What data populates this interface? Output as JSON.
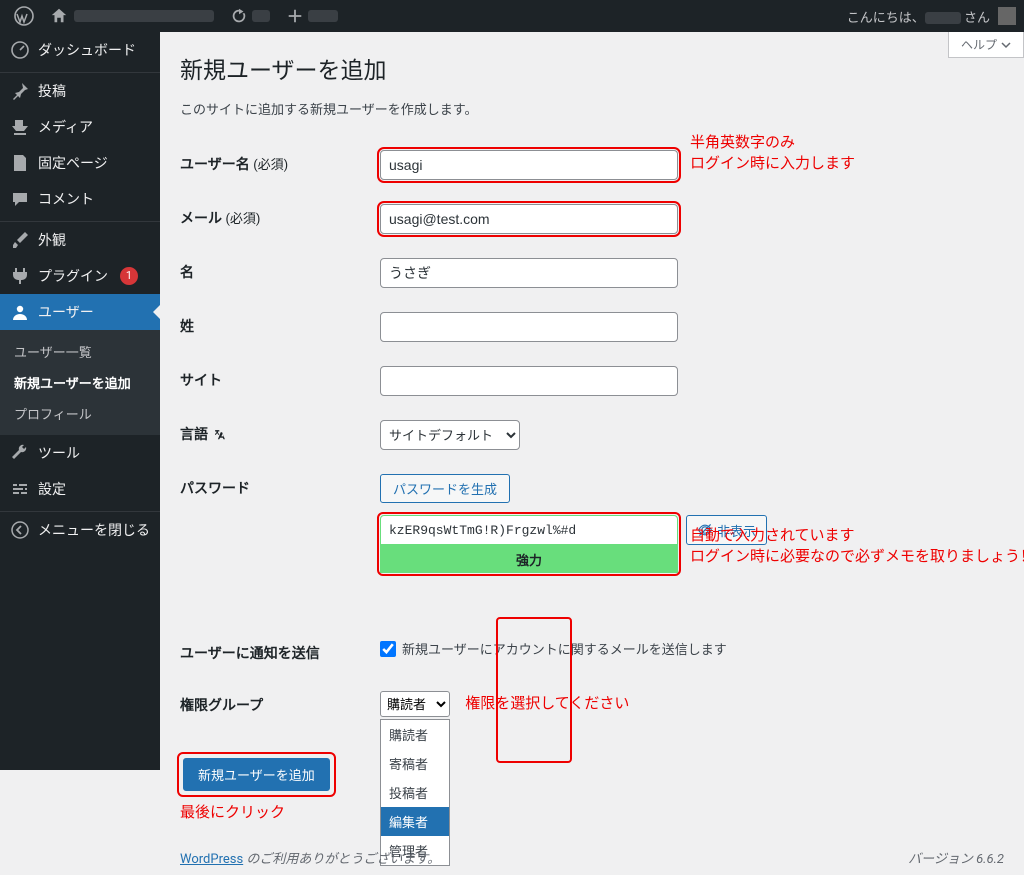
{
  "adminbar": {
    "greeting": "こんにちは、",
    "greeting_suffix": " さん"
  },
  "menu": {
    "dashboard": "ダッシュボード",
    "posts": "投稿",
    "media": "メディア",
    "pages": "固定ページ",
    "comments": "コメント",
    "appearance": "外観",
    "plugins": "プラグイン",
    "plugins_badge": "1",
    "users": "ユーザー",
    "tools": "ツール",
    "settings": "設定",
    "collapse": "メニューを閉じる",
    "sub_users_all": "ユーザー一覧",
    "sub_users_new": "新規ユーザーを追加",
    "sub_users_profile": "プロフィール"
  },
  "page": {
    "help": "ヘルプ",
    "title": "新規ユーザーを追加",
    "desc": "このサイトに追加する新規ユーザーを作成します。"
  },
  "form": {
    "username_label": "ユーザー名",
    "required": "(必須)",
    "username_value": "usagi",
    "email_label": "メール",
    "email_value": "usagi@test.com",
    "first_label": "名",
    "first_value": "うさぎ",
    "last_label": "姓",
    "last_value": "",
    "site_label": "サイト",
    "site_value": "",
    "lang_label": "言語",
    "lang_value": "サイトデフォルト",
    "pass_label": "パスワード",
    "pass_gen_btn": "パスワードを生成",
    "pass_value": "kzER9qsWtTmG!R)Frgzwl%#d",
    "pass_strength": "強力",
    "pass_hide": "非表示",
    "notify_label": "ユーザーに通知を送信",
    "notify_text": "新規ユーザーにアカウントに関するメールを送信します",
    "role_label": "権限グループ",
    "role_value": "購読者",
    "role_options": [
      "購読者",
      "寄稿者",
      "投稿者",
      "編集者",
      "管理者"
    ],
    "submit": "新規ユーザーを追加"
  },
  "annotations": {
    "username_hint_l1": "半角英数字のみ",
    "username_hint_l2": "ログイン時に入力します",
    "pass_hint_l1": "自動で入力されています",
    "pass_hint_l2": "ログイン時に必要なので必ずメモを取りましょう！",
    "role_hint": "権限を選択してください",
    "submit_hint": "最後にクリック"
  },
  "footer": {
    "wp_link": "WordPress",
    "thanks": "のご利用ありがとうございます。",
    "version": "バージョン 6.6.2"
  }
}
